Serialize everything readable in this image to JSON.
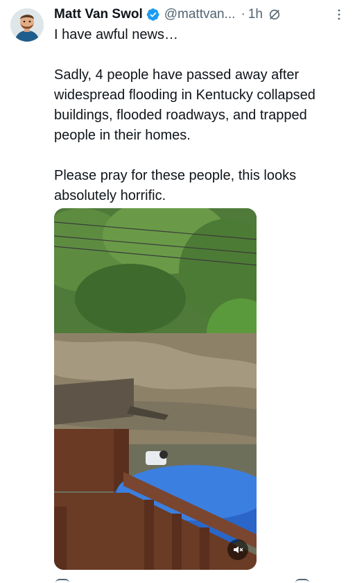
{
  "author": {
    "name": "Matt Van Swol",
    "handle": "@mattvan...",
    "dot": "·",
    "time": "1h"
  },
  "tweet": {
    "text": "I have awful news…\n\nSadly, 4 people have passed away after widespread flooding in Kentucky collapsed buildings, flooded roadways, and trapped people in their homes.\n\nPlease pray for these people, this looks absolutely horrific."
  },
  "icons": {
    "verified": "verified-badge-icon",
    "grok": "grok-icon",
    "more": "more-dots-icon",
    "mute": "muted-speaker-icon"
  },
  "colors": {
    "verified_blue": "#1d9bf0",
    "secondary_text": "#536471"
  }
}
